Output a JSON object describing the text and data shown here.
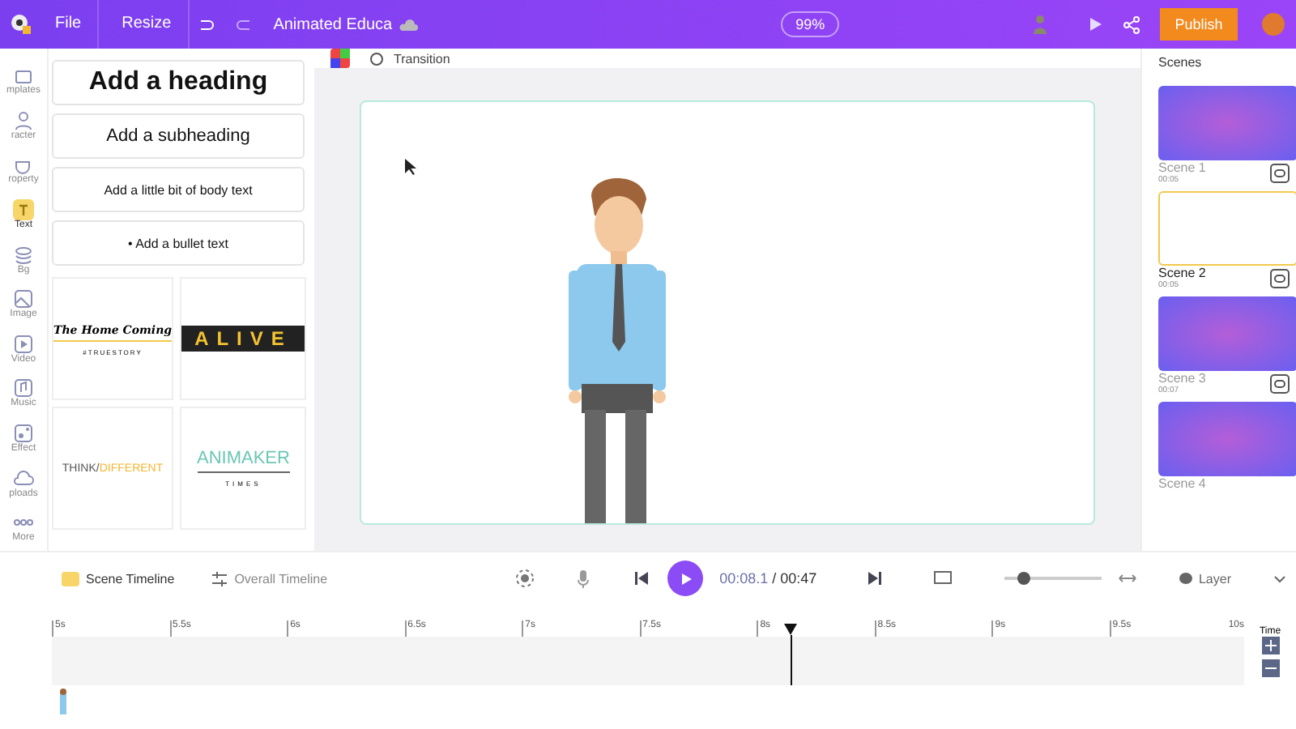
{
  "topbar": {
    "menu": [
      "File",
      "Resize"
    ],
    "project_title": "Animated Educa",
    "zoom": "99%",
    "publish": "Publish"
  },
  "rail": [
    {
      "label": "mplates",
      "selected": false
    },
    {
      "label": "racter",
      "selected": false
    },
    {
      "label": "roperty",
      "selected": false
    },
    {
      "label": "Text",
      "selected": true
    },
    {
      "label": "Bg",
      "selected": false
    },
    {
      "label": "Image",
      "selected": false
    },
    {
      "label": "Video",
      "selected": false
    },
    {
      "label": "Music",
      "selected": false
    },
    {
      "label": "Effect",
      "selected": false
    },
    {
      "label": "ploads",
      "selected": false
    },
    {
      "label": "More",
      "selected": false
    }
  ],
  "text_panel": {
    "styles": [
      {
        "kind": "heading",
        "label": "Add a heading"
      },
      {
        "kind": "subheading",
        "label": "Add a subheading"
      },
      {
        "kind": "body",
        "label": "Add a little bit of body text"
      },
      {
        "kind": "bullet",
        "label": "• Add a bullet text"
      }
    ],
    "templates": [
      {
        "kind": "homecoming",
        "title": "The Home Coming",
        "subtitle": "#TRUESTORY"
      },
      {
        "kind": "alive",
        "title": "ALIVE"
      },
      {
        "kind": "think",
        "title": "THINK/",
        "accent": "DIFFERENT"
      },
      {
        "kind": "animaker",
        "title": "ANIMAKER",
        "subtitle": "TIMES"
      }
    ]
  },
  "canvas_toolbar": {
    "transition": "Transition"
  },
  "scenes": {
    "title": "Scenes",
    "items": [
      {
        "name": "Scene 1",
        "duration": "00:05",
        "selected": false,
        "blank": false
      },
      {
        "name": "Scene 2",
        "duration": "00:05",
        "selected": true,
        "blank": true
      },
      {
        "name": "Scene 3",
        "duration": "00:07",
        "selected": false,
        "blank": false
      },
      {
        "name": "Scene 4",
        "selected": false,
        "blank": false
      }
    ]
  },
  "timeline": {
    "tabs": [
      {
        "label": "Scene Timeline",
        "selected": true
      },
      {
        "label": "Overall Timeline",
        "selected": false
      }
    ],
    "current_time": "00:08.1",
    "total_time": "/ 00:47",
    "zoom": {
      "level": 0.2
    },
    "layer": "Layer",
    "ticks": [
      "5s",
      "5.5s",
      "6s",
      "6.5s",
      "7s",
      "7.5s",
      "8s",
      "8.5s",
      "9s",
      "9.5s",
      "10s"
    ],
    "playhead": {
      "level": 0.62
    },
    "time_label": "Time"
  }
}
